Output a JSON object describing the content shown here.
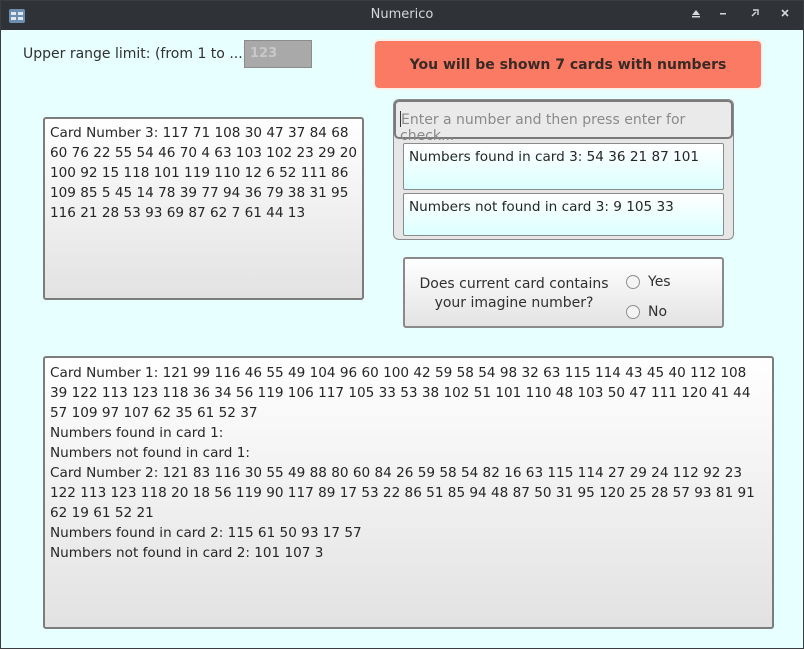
{
  "window": {
    "title": "Numerico",
    "app_icon": "app-icon",
    "controls": [
      "keep-above-icon",
      "minimize-icon",
      "maximize-icon",
      "close-icon"
    ]
  },
  "range": {
    "label": "Upper range limit: (from 1 to ...)",
    "value": "123"
  },
  "banner": {
    "text": "You will be shown 7 cards with numbers",
    "color": "#fa7a63"
  },
  "current_card": {
    "text": "Card Number 3: 117 71 108 30 47 37 84 68 60 76 22 55 54 46 70 4 63 103 102 23 29 20 100 92 15 118 101 119 110 12 6 52 111 86 109 85 5 45 14 78 39 77 94 36 79 38 31 95 116 21 28 53 93 69 87 62 7 61 44 13"
  },
  "check": {
    "placeholder": "Enter a number and then press enter for check...",
    "found": "Numbers found in card 3: 54 36 21 87 101",
    "not_found": "Numbers not found in card 3: 9 105 33"
  },
  "question": {
    "line1": "Does current card contains",
    "line2": "your imagine number?",
    "yes": "Yes",
    "no": "No"
  },
  "log": {
    "lines": [
      "Card Number 1: 121 99 116 46 55 49 104 96 60 100 42 59 58 54 98 32 63 115 114 43 45 40 112 108 39 122 113 123 118 36 34 56 119 106 117 105 33 53 38 102 51 101 110 48 103 50 47 111 120 41 44 57 109 97 107 62 35 61 52 37",
      "Numbers found in card 1:",
      "Numbers not found in card 1:",
      "Card Number 2: 121 83 116 30 55 49 88 80 60 84 26 59 58 54 82 16 63 115 114 27 29 24 112 92 23 122 113 123 118 20 18 56 119 90 117 89 17 53 22 86 51 85 94 48 87 50 31 95 120 25 28 57 93 81 91 62 19 61 52 21",
      "Numbers found in card 2: 115 61 50 93 17 57",
      "Numbers not found in card 2: 101 107 3"
    ]
  }
}
